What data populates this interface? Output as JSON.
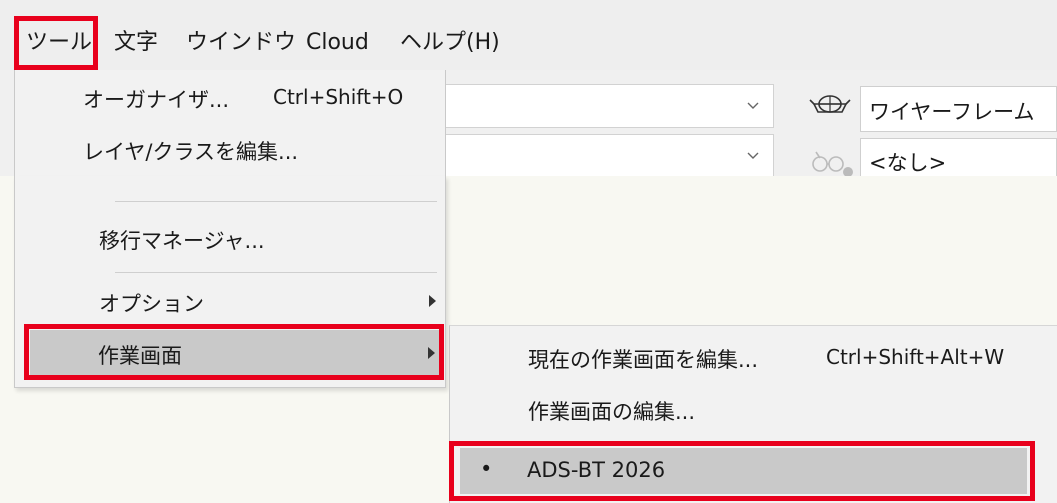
{
  "menubar": {
    "items": [
      "ツール",
      "文字",
      "ウインドウ",
      "Cloud",
      "ヘルプ(H)"
    ]
  },
  "tools_menu": {
    "items": [
      {
        "label": "オーガナイザ...",
        "shortcut": "Ctrl+Shift+O"
      },
      {
        "label": "レイヤ/クラスを編集..."
      },
      {
        "label": "移行マネージャ..."
      },
      {
        "label": "オプション"
      },
      {
        "label": "作業画面"
      }
    ]
  },
  "view_panel": {
    "render_mode": "ワイヤーフレーム",
    "light_setting": "<なし>"
  },
  "workscreen_submenu": {
    "items": [
      {
        "label": "現在の作業画面を編集...",
        "shortcut": "Ctrl+Shift+Alt+W"
      },
      {
        "label": "作業画面の編集..."
      },
      {
        "label": "ADS-BT 2026",
        "bullet": "•"
      }
    ]
  },
  "colors": {
    "highlight_red": "#e8001c",
    "menu_bg": "#f2f2f2",
    "selected_bg": "#c9c9c9"
  }
}
